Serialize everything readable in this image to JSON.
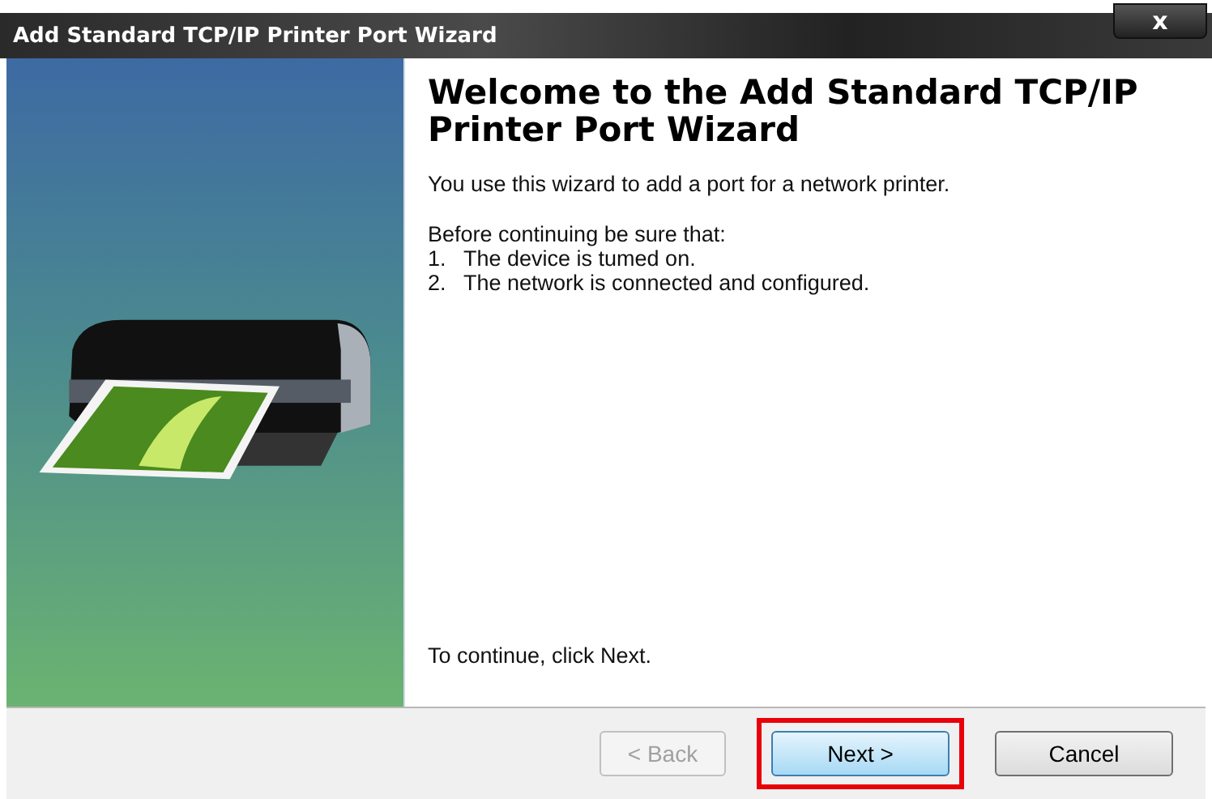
{
  "window": {
    "title": "Add Standard TCP/IP Printer Port Wizard",
    "close_label": "x"
  },
  "heading": "Welcome to the Add Standard TCP/IP Printer Port Wizard",
  "intro": "You use this wizard to add a port for a network printer.",
  "checklist_title": "Before continuing be sure that:",
  "checklist": [
    {
      "number": "1.",
      "text": "The device is tumed on."
    },
    {
      "number": "2.",
      "text": "The network is connected and configured."
    }
  ],
  "footer_text": "To continue, click Next.",
  "buttons": [
    {
      "label": "< Back",
      "disabled": true,
      "default": false,
      "highlighted": false
    },
    {
      "label": "Next >",
      "disabled": false,
      "default": true,
      "highlighted": true
    },
    {
      "label": "Cancel",
      "disabled": false,
      "default": false,
      "highlighted": false
    }
  ]
}
